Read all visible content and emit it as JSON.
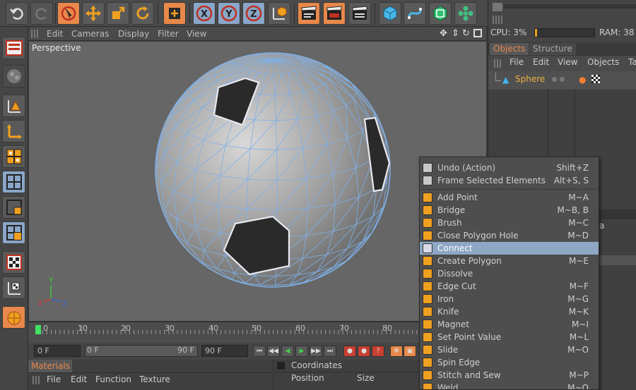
{
  "viewport": {
    "menu": [
      "Edit",
      "Cameras",
      "Display",
      "Filter",
      "View"
    ],
    "label": "Perspective",
    "axes": {
      "x": "X",
      "y": "Y",
      "z": "Z"
    }
  },
  "timeline": {
    "ticks": [
      "0",
      "10",
      "20",
      "30",
      "40",
      "50",
      "60",
      "70",
      "80"
    ],
    "start_field": "0 F",
    "range_start": "0 F",
    "range_end": "90 F",
    "end_field": "90 F"
  },
  "materials": {
    "tab": "Materials",
    "menu": [
      "File",
      "Edit",
      "Function",
      "Texture"
    ]
  },
  "coordinates": {
    "title": "Coordinates",
    "cols": [
      "Position",
      "Size"
    ]
  },
  "status": {
    "cpu_label": "CPU: 3%",
    "ram_label": "RAM: 38"
  },
  "objects_panel": {
    "tabs": [
      "Objects",
      "Structure"
    ],
    "menu": [
      "File",
      "Edit",
      "View",
      "Objects",
      "Ta"
    ],
    "object_name": "Sphere",
    "side_letter": "a"
  },
  "context_menu": {
    "items": [
      {
        "label": "Undo (Action)",
        "shortcut": "Shift+Z",
        "icon": "undo-icon"
      },
      {
        "label": "Frame Selected Elements",
        "shortcut": "Alt+S, S",
        "icon": "frame-icon"
      },
      {
        "label": "Add Point",
        "shortcut": "M~A",
        "icon": "add-point-icon"
      },
      {
        "label": "Bridge",
        "shortcut": "M~B, B",
        "icon": "bridge-icon"
      },
      {
        "label": "Brush",
        "shortcut": "M~C",
        "icon": "brush-icon"
      },
      {
        "label": "Close Polygon Hole",
        "shortcut": "M~D",
        "icon": "close-hole-icon"
      },
      {
        "label": "Connect",
        "shortcut": "",
        "icon": "connect-icon",
        "highlighted": true
      },
      {
        "label": "Create Polygon",
        "shortcut": "M~E",
        "icon": "create-polygon-icon"
      },
      {
        "label": "Dissolve",
        "shortcut": "",
        "icon": "dissolve-icon"
      },
      {
        "label": "Edge Cut",
        "shortcut": "M~F",
        "icon": "edge-cut-icon"
      },
      {
        "label": "Iron",
        "shortcut": "M~G",
        "icon": "iron-icon"
      },
      {
        "label": "Knife",
        "shortcut": "M~K",
        "icon": "knife-icon"
      },
      {
        "label": "Magnet",
        "shortcut": "M~I",
        "icon": "magnet-icon"
      },
      {
        "label": "Set Point Value",
        "shortcut": "M~L",
        "icon": "set-point-icon"
      },
      {
        "label": "Slide",
        "shortcut": "M~O",
        "icon": "slide-icon"
      },
      {
        "label": "Spin Edge",
        "shortcut": "",
        "icon": "spin-edge-icon"
      },
      {
        "label": "Stitch and Sew",
        "shortcut": "M~P",
        "icon": "stitch-icon"
      },
      {
        "label": "Weld",
        "shortcut": "M~Q",
        "icon": "weld-icon"
      }
    ]
  },
  "colors": {
    "accent_orange": "#e8884a",
    "highlight_blue": "#8ea7c4",
    "viewport_bg": "#666666",
    "wire": "#7fb0e8"
  },
  "toolbar_icons": [
    "undo-icon",
    "redo-icon",
    "live-selection-icon",
    "move-icon",
    "scale-icon",
    "rotate-icon",
    "coord-system-icon",
    "x-axis-icon",
    "y-axis-icon",
    "z-axis-icon",
    "world-coords-icon",
    "render-view-icon",
    "render-picture-icon",
    "render-settings-icon",
    "cube-icon",
    "spline-icon",
    "nurbs-icon",
    "array-icon"
  ]
}
